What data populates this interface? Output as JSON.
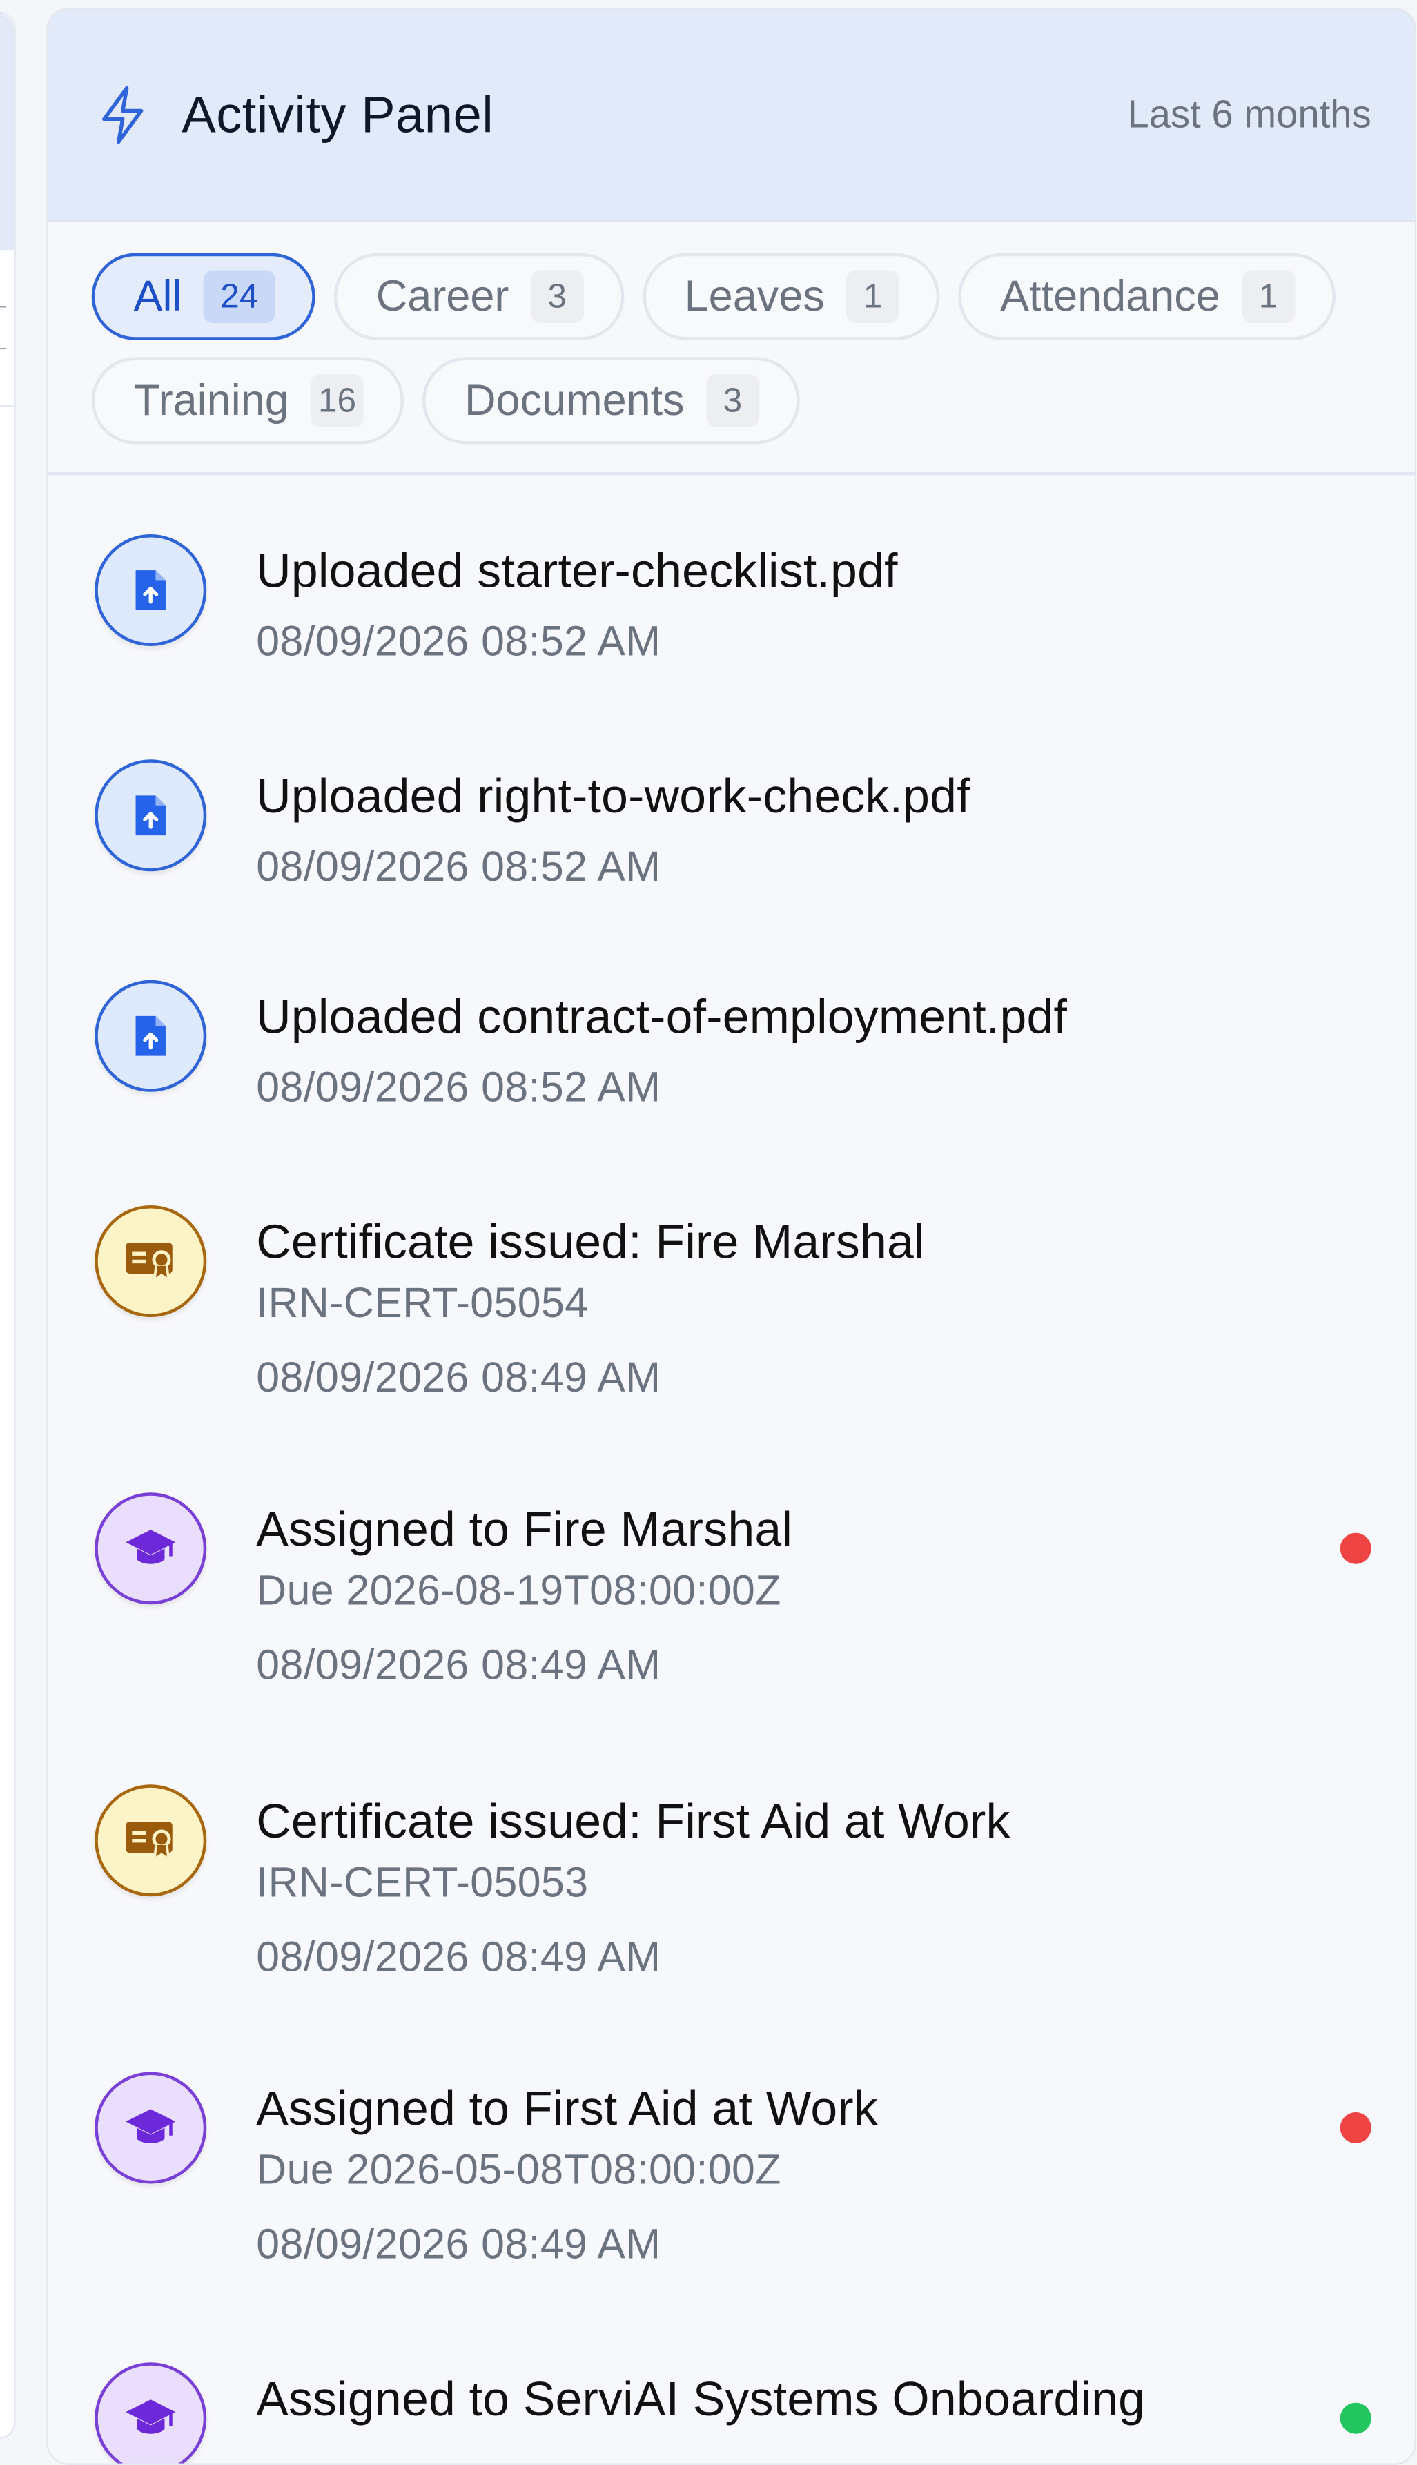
{
  "panel": {
    "title": "Activity Panel",
    "range": "Last 6 months",
    "accent": "#2f64d8"
  },
  "filters": [
    {
      "label": "All",
      "count": "24",
      "active": true
    },
    {
      "label": "Career",
      "count": "3",
      "active": false
    },
    {
      "label": "Leaves",
      "count": "1",
      "active": false
    },
    {
      "label": "Attendance",
      "count": "1",
      "active": false
    },
    {
      "label": "Training",
      "count": "16",
      "active": false
    },
    {
      "label": "Documents",
      "count": "3",
      "active": false
    }
  ],
  "activities": [
    {
      "kind": "document",
      "icon": "file-upload-icon",
      "title": "Uploaded starter-checklist.pdf",
      "detail": "",
      "time": "08/09/2026 08:52 AM",
      "status": ""
    },
    {
      "kind": "document",
      "icon": "file-upload-icon",
      "title": "Uploaded right-to-work-check.pdf",
      "detail": "",
      "time": "08/09/2026 08:52 AM",
      "status": ""
    },
    {
      "kind": "document",
      "icon": "file-upload-icon",
      "title": "Uploaded contract-of-employment.pdf",
      "detail": "",
      "time": "08/09/2026 08:52 AM",
      "status": ""
    },
    {
      "kind": "certificate",
      "icon": "certificate-icon",
      "title": "Certificate issued: Fire Marshal",
      "detail": "IRN-CERT-05054",
      "time": "08/09/2026 08:49 AM",
      "status": ""
    },
    {
      "kind": "training",
      "icon": "graduation-cap-icon",
      "title": "Assigned to Fire Marshal",
      "detail": "Due 2026-08-19T08:00:00Z",
      "time": "08/09/2026 08:49 AM",
      "status": "#ef4444"
    },
    {
      "kind": "certificate",
      "icon": "certificate-icon",
      "title": "Certificate issued: First Aid at Work",
      "detail": "IRN-CERT-05053",
      "time": "08/09/2026 08:49 AM",
      "status": ""
    },
    {
      "kind": "training",
      "icon": "graduation-cap-icon",
      "title": "Assigned to First Aid at Work",
      "detail": "Due 2026-05-08T08:00:00Z",
      "time": "08/09/2026 08:49 AM",
      "status": "#ef4444"
    },
    {
      "kind": "training",
      "icon": "graduation-cap-icon",
      "title": "Assigned to ServiAI Systems Onboarding",
      "detail": "",
      "time": "",
      "status": "#22c55e"
    }
  ]
}
